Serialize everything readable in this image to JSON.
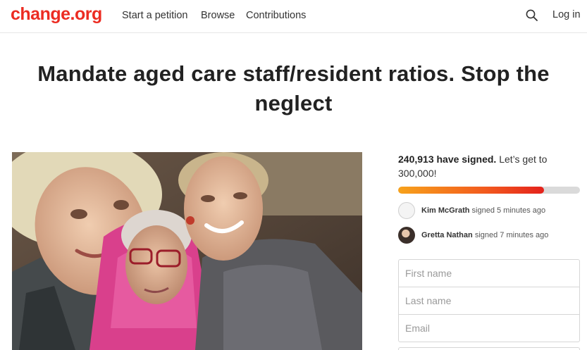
{
  "header": {
    "logo": "change.org",
    "nav": {
      "start_petition": "Start a petition",
      "browse": "Browse",
      "contributions": "Contributions"
    },
    "search_icon": "search-icon",
    "login": "Log in"
  },
  "petition": {
    "title": "Mandate aged care staff/resident ratios. Stop the neglect"
  },
  "signatures": {
    "count_text": "240,913 have signed.",
    "goal_text": "Let’s get to 300,000!",
    "progress_fraction": 0.803
  },
  "recent_signers": [
    {
      "name": "Kim McGrath",
      "action": "signed 5 minutes ago"
    },
    {
      "name": "Gretta Nathan",
      "action": "signed 7 minutes ago"
    }
  ],
  "form": {
    "first_name_placeholder": "First name",
    "last_name_placeholder": "Last name",
    "email_placeholder": "Email"
  },
  "colors": {
    "brand": "#ec2c22",
    "progress_start": "#f7a21b",
    "progress_end": "#e4221c"
  }
}
